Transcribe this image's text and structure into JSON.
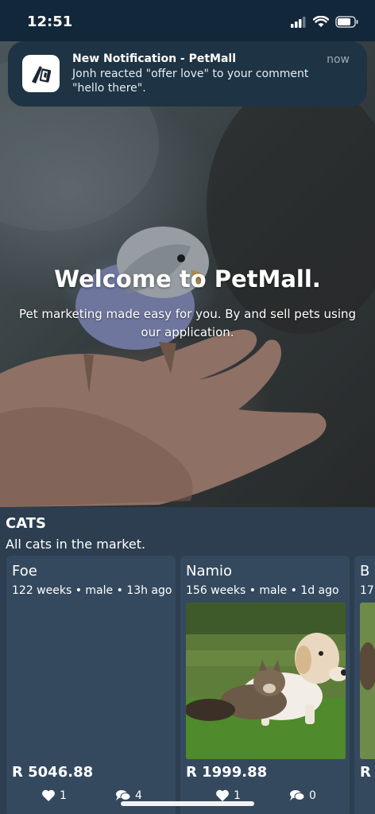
{
  "status_bar": {
    "time": "12:51"
  },
  "notification": {
    "title": "New Notification - PetMall",
    "body": "Jonh reacted \"offer love\" to your comment \"hello there\".",
    "time": "now"
  },
  "hero": {
    "title": "Welcome to PetMall.",
    "subtitle": "Pet marketing made easy for you. By and sell pets using our application."
  },
  "section": {
    "title": "CATS",
    "subtitle": "All cats in the market."
  },
  "cards": [
    {
      "name": "Foe",
      "meta": "122 weeks • male • 13h ago",
      "price": "R 5046.88",
      "likes": "1",
      "comments": "4"
    },
    {
      "name": "Namio",
      "meta": "156 weeks • male • 1d ago",
      "price": "R 1999.88",
      "likes": "1",
      "comments": "0"
    },
    {
      "name": "B",
      "meta": "17",
      "price": "R"
    }
  ]
}
